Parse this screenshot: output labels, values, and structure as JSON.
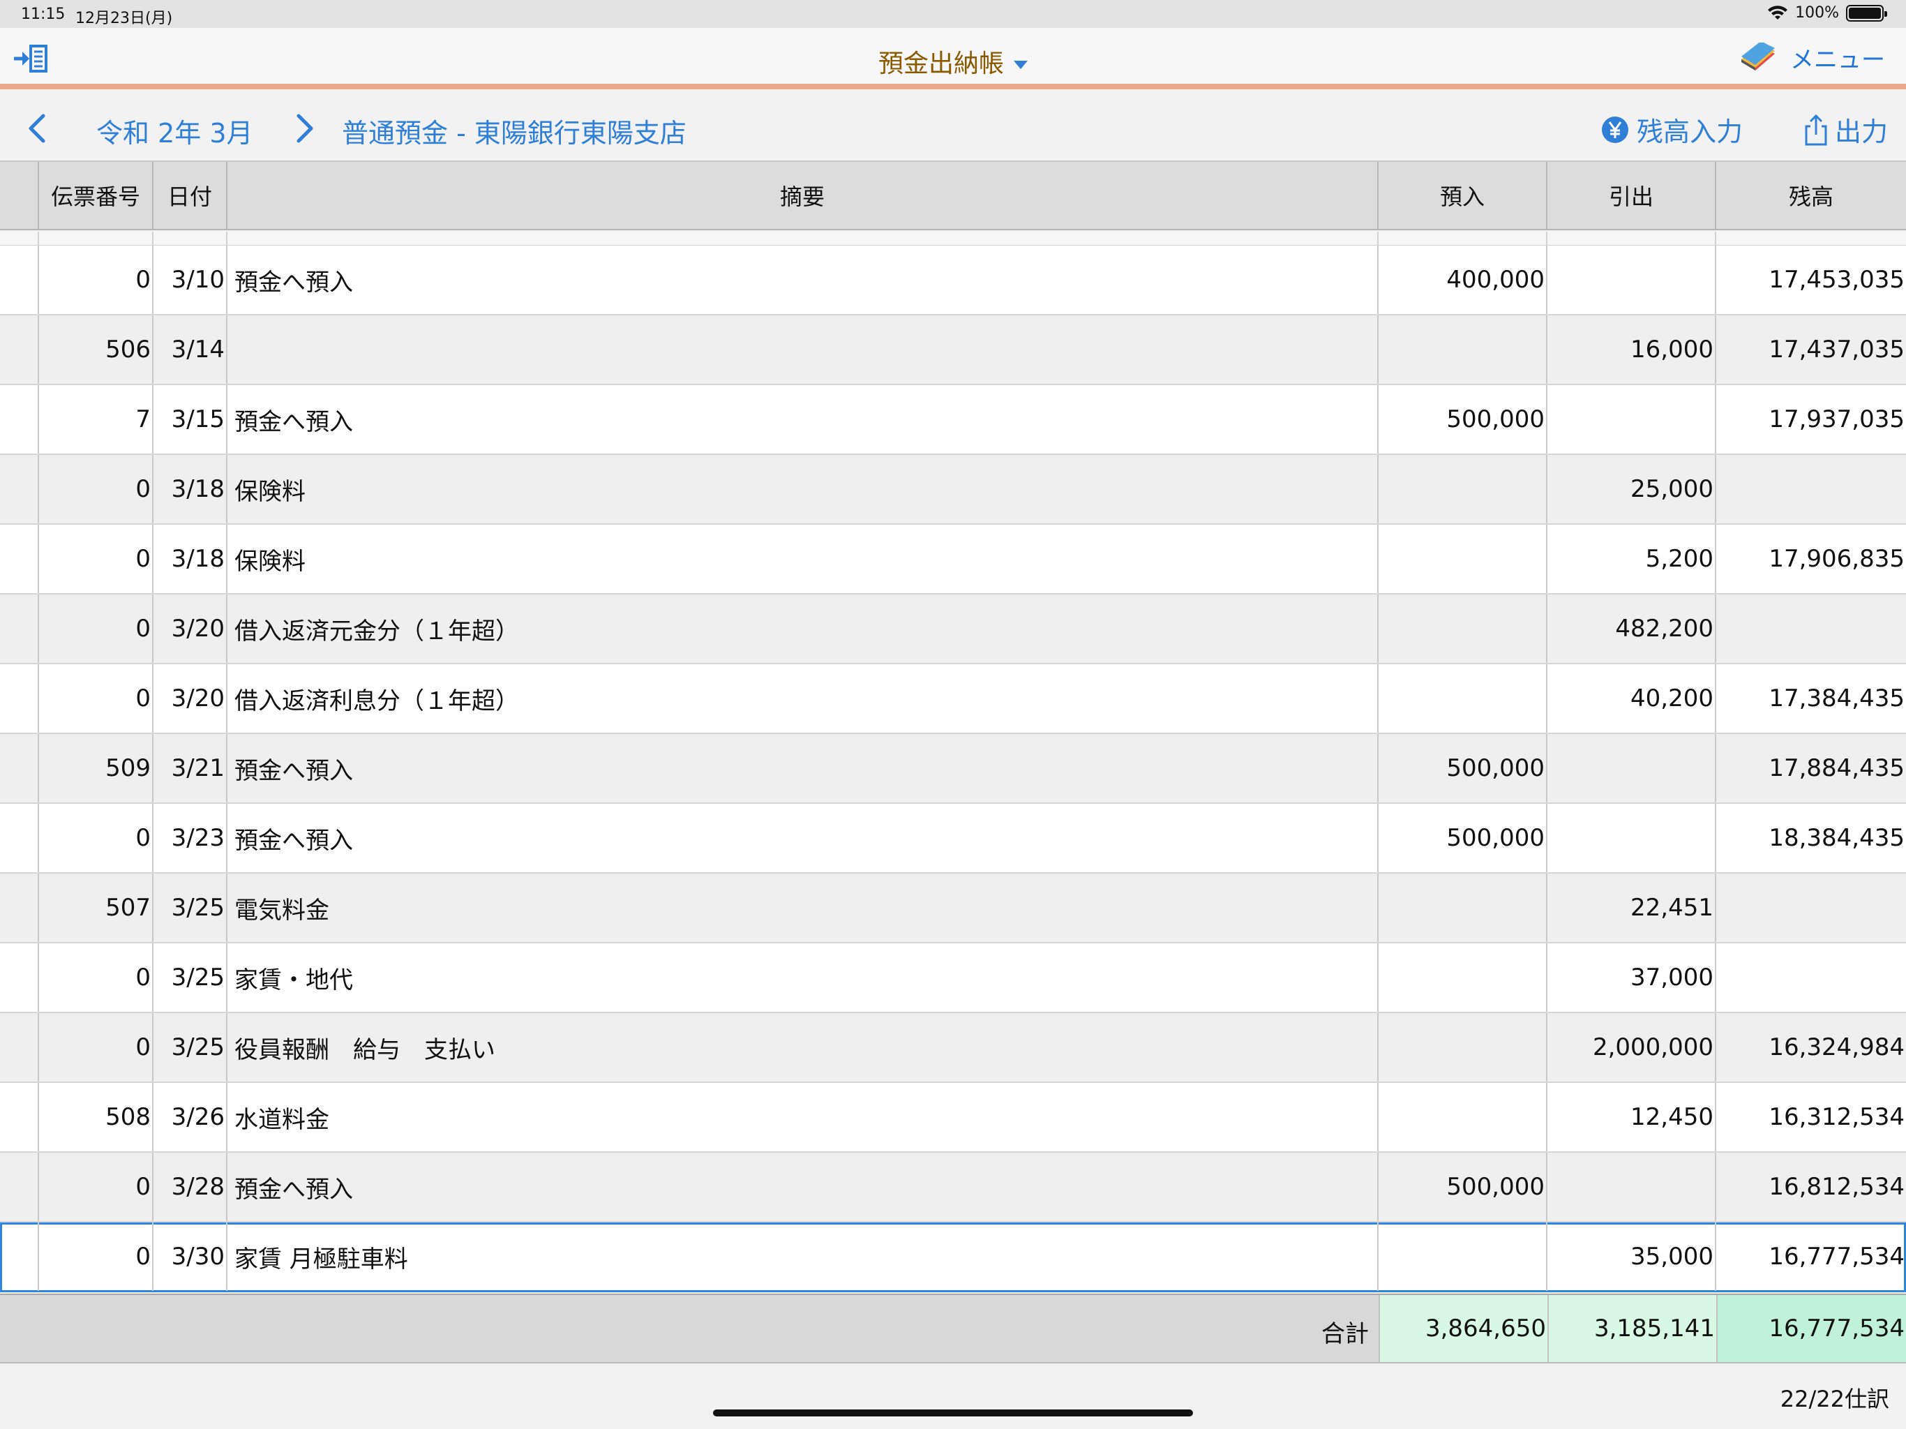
{
  "status": {
    "time": "11:15",
    "date": "12月23日(月)",
    "battery": "100%"
  },
  "nav": {
    "title": "預金出納帳",
    "menu_label": "メニュー"
  },
  "subbar": {
    "period": "令和 2年 3月",
    "account": "普通預金 - 東陽銀行東陽支店",
    "balance_input": "残高入力",
    "export": "出力"
  },
  "table": {
    "headers": [
      "伝票番号",
      "日付",
      "摘要",
      "預入",
      "引出",
      "残高"
    ],
    "rows": [
      {
        "no": "0",
        "date": "3/10",
        "desc": "預金へ預入",
        "deposit": "400,000",
        "withdraw": "",
        "balance": "17,453,035"
      },
      {
        "no": "506",
        "date": "3/14",
        "desc": "",
        "deposit": "",
        "withdraw": "16,000",
        "balance": "17,437,035"
      },
      {
        "no": "7",
        "date": "3/15",
        "desc": "預金へ預入",
        "deposit": "500,000",
        "withdraw": "",
        "balance": "17,937,035"
      },
      {
        "no": "0",
        "date": "3/18",
        "desc": "保険料",
        "deposit": "",
        "withdraw": "25,000",
        "balance": ""
      },
      {
        "no": "0",
        "date": "3/18",
        "desc": "保険料",
        "deposit": "",
        "withdraw": "5,200",
        "balance": "17,906,835"
      },
      {
        "no": "0",
        "date": "3/20",
        "desc": "借入返済元金分（１年超）",
        "deposit": "",
        "withdraw": "482,200",
        "balance": ""
      },
      {
        "no": "0",
        "date": "3/20",
        "desc": "借入返済利息分（１年超）",
        "deposit": "",
        "withdraw": "40,200",
        "balance": "17,384,435"
      },
      {
        "no": "509",
        "date": "3/21",
        "desc": "預金へ預入",
        "deposit": "500,000",
        "withdraw": "",
        "balance": "17,884,435"
      },
      {
        "no": "0",
        "date": "3/23",
        "desc": "預金へ預入",
        "deposit": "500,000",
        "withdraw": "",
        "balance": "18,384,435"
      },
      {
        "no": "507",
        "date": "3/25",
        "desc": "電気料金",
        "deposit": "",
        "withdraw": "22,451",
        "balance": ""
      },
      {
        "no": "0",
        "date": "3/25",
        "desc": "家賃・地代",
        "deposit": "",
        "withdraw": "37,000",
        "balance": ""
      },
      {
        "no": "0",
        "date": "3/25",
        "desc": "役員報酬　給与　支払い",
        "deposit": "",
        "withdraw": "2,000,000",
        "balance": "16,324,984"
      },
      {
        "no": "508",
        "date": "3/26",
        "desc": "水道料金",
        "deposit": "",
        "withdraw": "12,450",
        "balance": "16,312,534"
      },
      {
        "no": "0",
        "date": "3/28",
        "desc": "預金へ預入",
        "deposit": "500,000",
        "withdraw": "",
        "balance": "16,812,534"
      },
      {
        "no": "0",
        "date": "3/30",
        "desc": "家賃 月極駐車料",
        "deposit": "",
        "withdraw": "35,000",
        "balance": "16,777,534"
      }
    ],
    "total": {
      "label": "合計",
      "deposit": "3,864,650",
      "withdraw": "3,185,141",
      "balance": "16,777,534"
    }
  },
  "footer": {
    "count": "22/22仕訳"
  },
  "colors": {
    "accent_blue": "#2f7fd6",
    "title_brown": "#8b5a00",
    "orange_rule": "#e9a98a",
    "total_green": "#d8f7e4",
    "balance_green": "#bff2d8"
  }
}
